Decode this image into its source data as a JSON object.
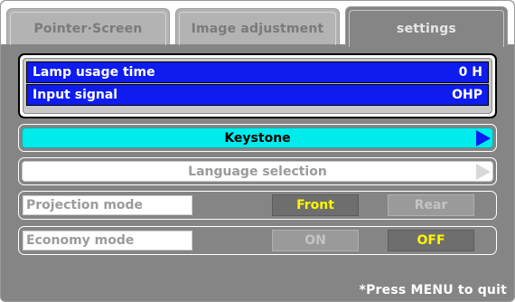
{
  "tabs": [
    {
      "label": "Pointer·Screen",
      "active": false
    },
    {
      "label": "Image adjustment",
      "active": false
    },
    {
      "label": "settings",
      "active": true
    }
  ],
  "info": {
    "lamp_usage_label": "Lamp usage time",
    "lamp_usage_value": "0 H",
    "input_signal_label": "Input signal",
    "input_signal_value": "OHP"
  },
  "menu": {
    "keystone_label": "Keystone",
    "language_label": "Language selection"
  },
  "projection_mode": {
    "label": "Projection mode",
    "options": [
      "Front",
      "Rear"
    ],
    "selected": "Front"
  },
  "economy_mode": {
    "label": "Economy mode",
    "options": [
      "ON",
      "OFF"
    ],
    "selected": "OFF"
  },
  "footer": {
    "hint": "*Press MENU to quit"
  },
  "colors": {
    "panel_bg": "#858585",
    "info_blue": "#0e1cf0",
    "highlight_cyan": "#00ebeb",
    "selected_text_yellow": "#fff700"
  },
  "icons": {
    "submenu_arrow": "triangle-right-icon"
  }
}
